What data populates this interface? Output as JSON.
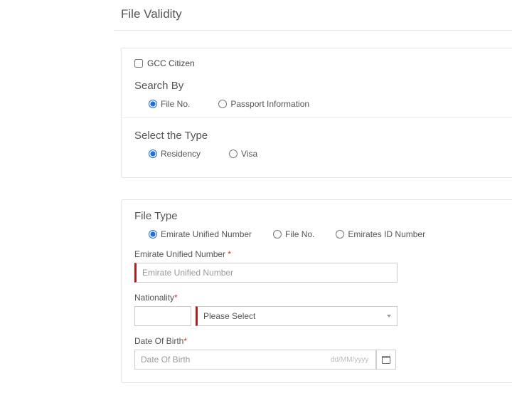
{
  "pageTitle": "File Validity",
  "gcc": {
    "label": "GCC Citizen",
    "checked": false
  },
  "searchBy": {
    "heading": "Search By",
    "options": [
      "File No.",
      "Passport Information"
    ],
    "selected": "File No."
  },
  "selectType": {
    "heading": "Select the Type",
    "options": [
      "Residency",
      "Visa"
    ],
    "selected": "Residency"
  },
  "fileType": {
    "heading": "File Type",
    "options": [
      "Emirate Unified Number",
      "File No.",
      "Emirates ID Number"
    ],
    "selected": "Emirate Unified Number"
  },
  "eun": {
    "label": "Emirate Unified Number ",
    "required": "*",
    "placeholder": "Emirate Unified Number",
    "value": ""
  },
  "nationality": {
    "label": "Nationality",
    "required": "*",
    "codeValue": "",
    "selectedText": "Please Select"
  },
  "dob": {
    "label": "Date Of Birth",
    "required": "*",
    "placeholder": "Date Of Birth",
    "hint": "dd/MM/yyyy",
    "value": ""
  }
}
